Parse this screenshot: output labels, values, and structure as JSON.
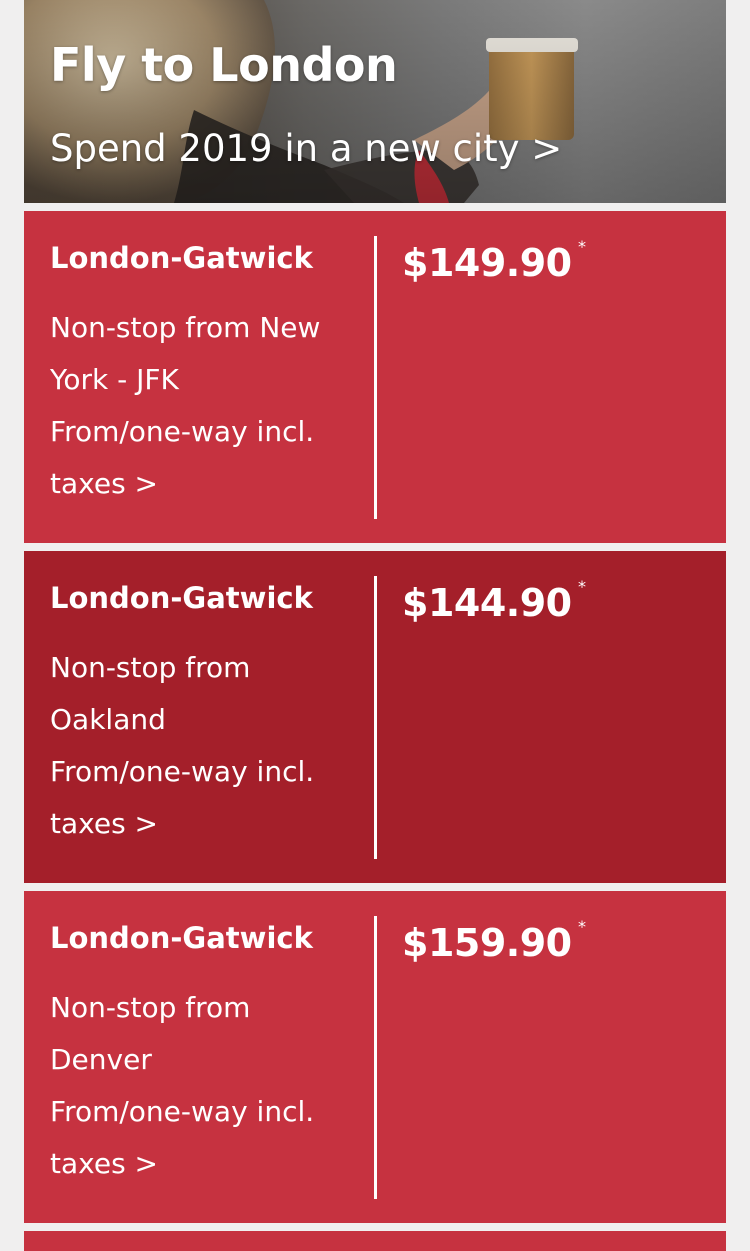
{
  "hero": {
    "title": "Fly to London",
    "subtitle": "Spend 2019 in a new city >"
  },
  "deals": [
    {
      "destination": "London-Gatwick",
      "origin_text": "Non-stop from New York - JFK",
      "fare_note": "From/one-way incl. taxes >",
      "price": "$149.90",
      "asterisk": "*",
      "background": "#c63240"
    },
    {
      "destination": "London-Gatwick",
      "origin_text": "Non-stop from Oakland",
      "fare_note": "From/one-way incl. taxes >",
      "price": "$144.90",
      "asterisk": "*",
      "background": "#a41f2a"
    },
    {
      "destination": "London-Gatwick",
      "origin_text": "Non-stop from Denver",
      "fare_note": "From/one-way incl. taxes >",
      "price": "$159.90",
      "asterisk": "*",
      "background": "#c63240"
    }
  ],
  "colors": {
    "page_background": "#f0efef",
    "card_red": "#c63240",
    "card_red_pressed": "#a41f2a",
    "text": "#ffffff"
  }
}
